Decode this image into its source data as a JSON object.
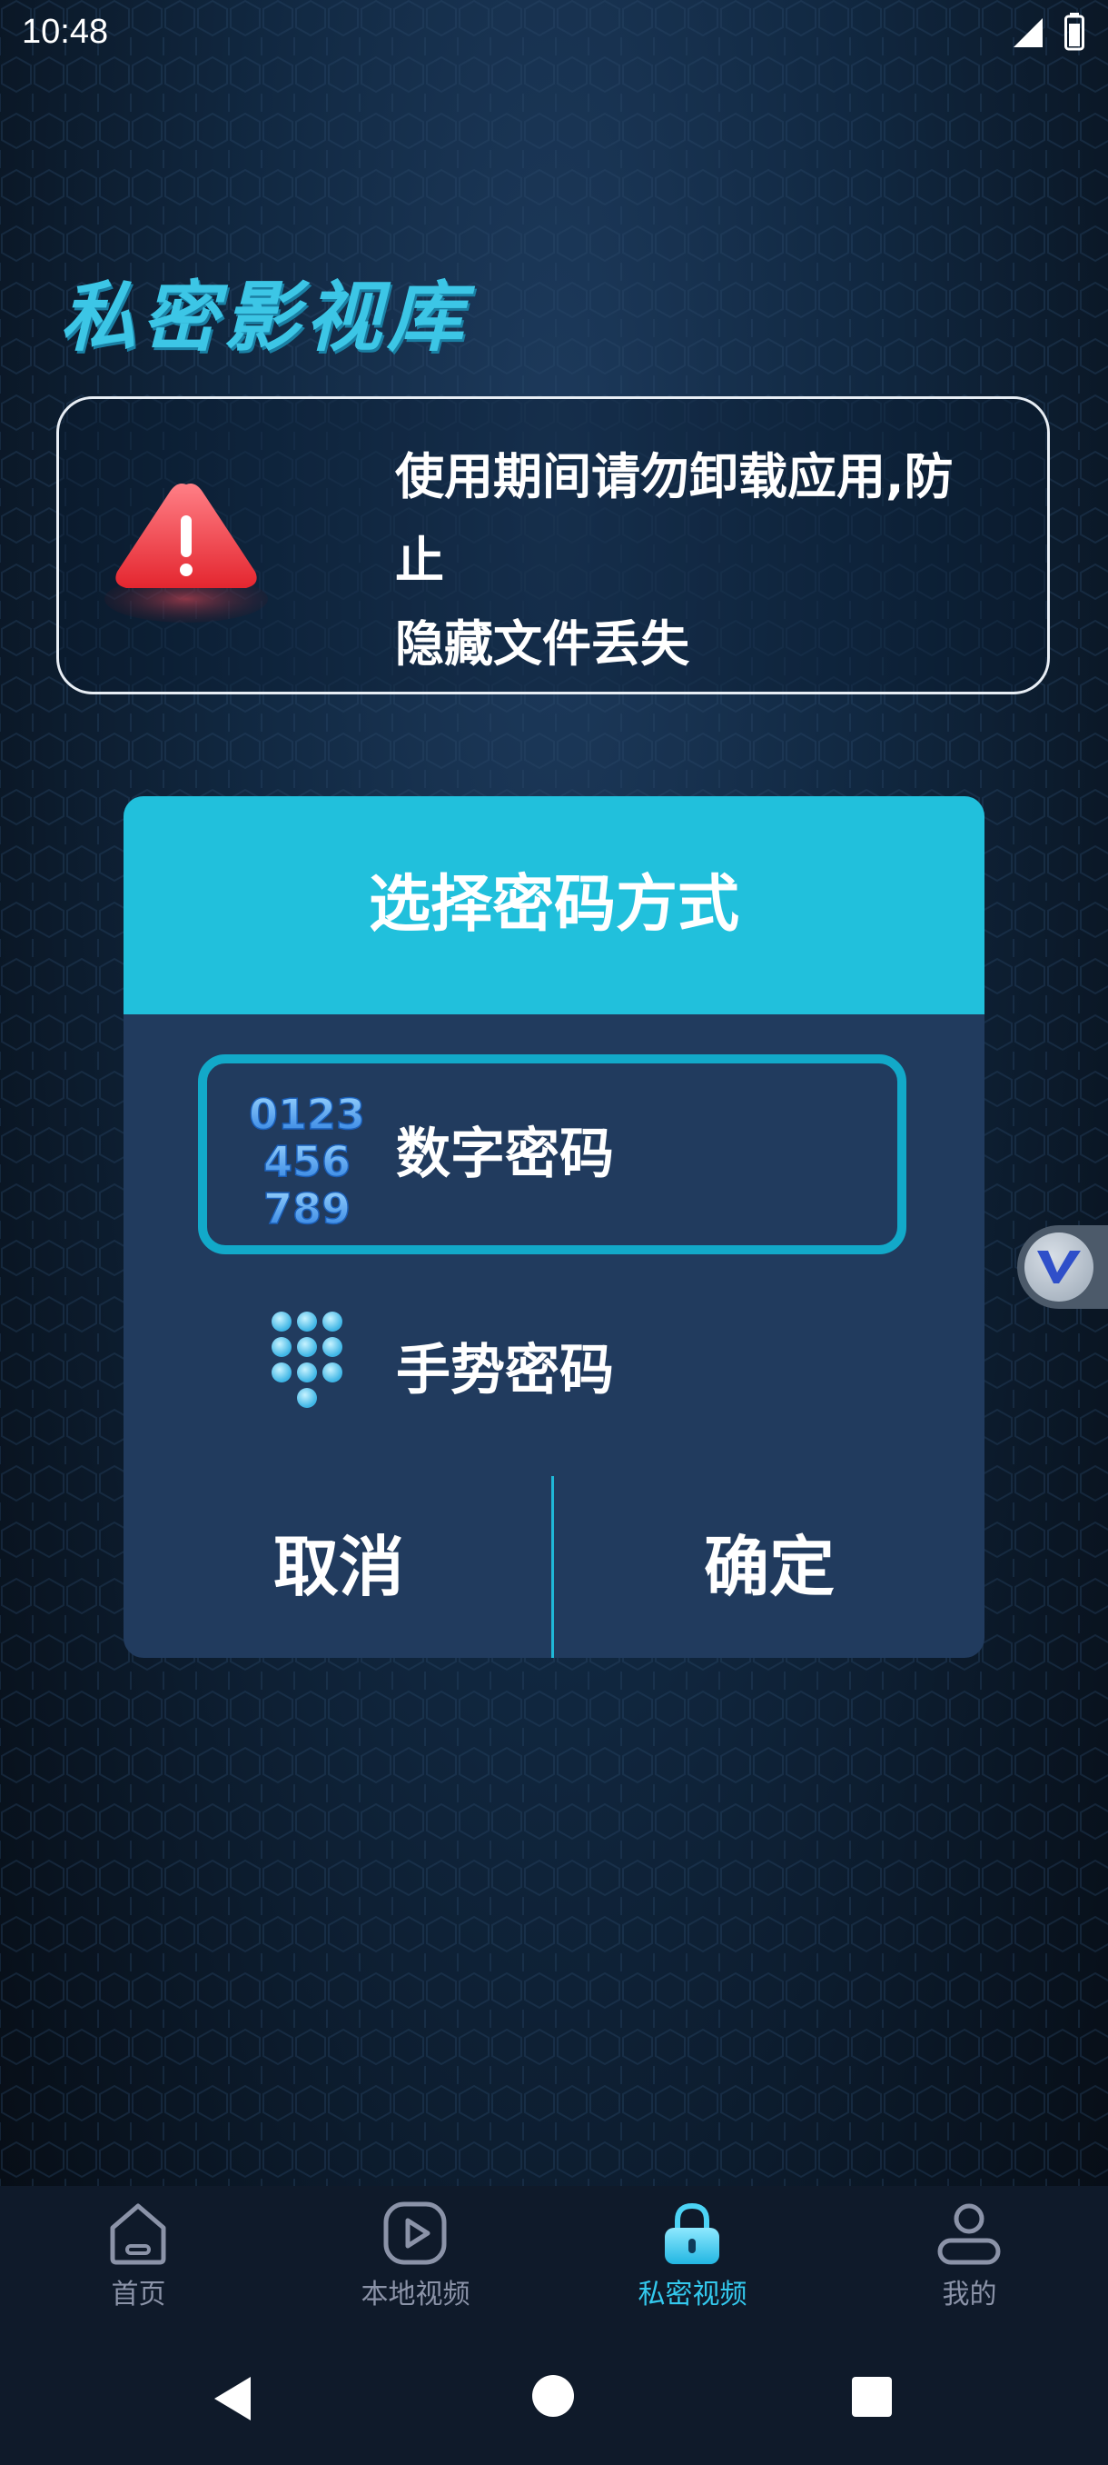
{
  "status_bar": {
    "time": "10:48"
  },
  "app_title": "私密影视库",
  "warning": {
    "text": "使用期间请勿卸载应用,防\n止\n隐藏文件丢失"
  },
  "dialog": {
    "title": "选择密码方式",
    "options": [
      {
        "label": "数字密码",
        "selected": true,
        "icon": "numeric-keypad-icon",
        "icon_text": [
          "0123",
          "456",
          "789"
        ]
      },
      {
        "label": "手势密码",
        "selected": false,
        "icon": "dot-grid-icon"
      }
    ],
    "cancel_label": "取消",
    "confirm_label": "确定"
  },
  "bottom_nav": {
    "items": [
      {
        "label": "首页",
        "icon": "home-icon",
        "active": false
      },
      {
        "label": "本地视频",
        "icon": "play-icon",
        "active": false
      },
      {
        "label": "私密视频",
        "icon": "lock-icon",
        "active": true
      },
      {
        "label": "我的",
        "icon": "user-icon",
        "active": false
      }
    ]
  },
  "colors": {
    "accent": "#21c0dc",
    "dialog_bg": "#213b5e",
    "active_nav": "#33c9ee",
    "inactive_nav": "#8b93a8",
    "warning_red": "#e8323c"
  }
}
